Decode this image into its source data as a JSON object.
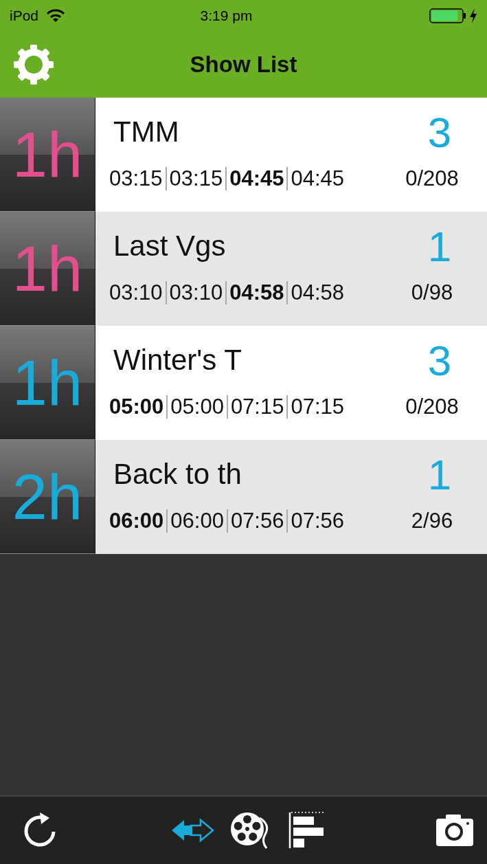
{
  "status_bar": {
    "carrier": "iPod",
    "time": "3:19 pm"
  },
  "nav_bar": {
    "title": "Show List"
  },
  "shows": [
    {
      "duration": "1h",
      "color": "#e2508f",
      "title": "TMM",
      "count": "3",
      "times": [
        {
          "text": "03:15",
          "bold": false
        },
        {
          "text": "03:15",
          "bold": false
        },
        {
          "text": "04:45",
          "bold": true
        },
        {
          "text": "04:45",
          "bold": false
        }
      ],
      "seats": "0/208"
    },
    {
      "duration": "1h",
      "color": "#e2508f",
      "title": "Last Vgs",
      "count": "1",
      "times": [
        {
          "text": "03:10",
          "bold": false
        },
        {
          "text": "03:10",
          "bold": false
        },
        {
          "text": "04:58",
          "bold": true
        },
        {
          "text": "04:58",
          "bold": false
        }
      ],
      "seats": "0/98"
    },
    {
      "duration": "1h",
      "color": "#19acd9",
      "title": "Winter's T",
      "count": "3",
      "times": [
        {
          "text": "05:00",
          "bold": true
        },
        {
          "text": "05:00",
          "bold": false
        },
        {
          "text": "07:15",
          "bold": false
        },
        {
          "text": "07:15",
          "bold": false
        }
      ],
      "seats": "0/208"
    },
    {
      "duration": "2h",
      "color": "#19acd9",
      "title": "Back to th",
      "count": "1",
      "times": [
        {
          "text": "06:00",
          "bold": true
        },
        {
          "text": "06:00",
          "bold": false
        },
        {
          "text": "07:56",
          "bold": false
        },
        {
          "text": "07:56",
          "bold": false
        }
      ],
      "seats": "2/96"
    }
  ],
  "toolbar": {
    "left": [
      {
        "kind": "refresh",
        "selected": false
      }
    ],
    "center": [
      {
        "kind": "swap",
        "selected": true
      },
      {
        "kind": "reel",
        "selected": false
      },
      {
        "kind": "chart",
        "selected": false
      }
    ],
    "right": [
      {
        "kind": "camera",
        "selected": false
      }
    ]
  }
}
